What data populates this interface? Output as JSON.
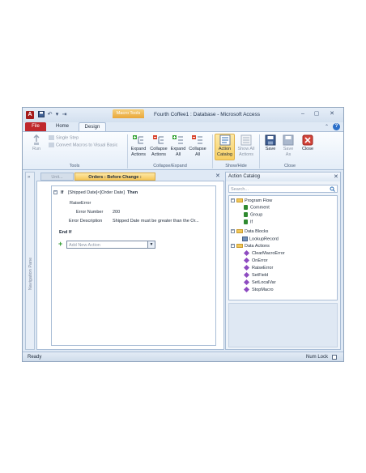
{
  "titlebar": {
    "app_icon": "A",
    "window_title": "Fourth Coffee1 : Database - Microsoft Access",
    "context_tab": "Macro Tools",
    "qat_icons": [
      "save-icon",
      "undo-icon",
      "redo-icon",
      "customize-icon"
    ],
    "controls": {
      "minimize": "–",
      "maximize": "▢",
      "close": "✕"
    }
  },
  "ribbon_tabs": {
    "file": "File",
    "home": "Home",
    "design": "Design",
    "active": "Design"
  },
  "ribbon": {
    "tools": {
      "label": "Tools",
      "run": "Run",
      "single_step": "Single Step",
      "convert": "Convert Macros to Visual Basic"
    },
    "collapse_expand": {
      "label": "Collapse/Expand",
      "expand_actions": [
        "Expand",
        "Actions"
      ],
      "collapse_actions": [
        "Collapse",
        "Actions"
      ],
      "expand_all": [
        "Expand",
        "All"
      ],
      "collapse_all": [
        "Collapse",
        "All"
      ]
    },
    "show_hide": {
      "label": "Show/Hide",
      "action_catalog": [
        "Action",
        "Catalog"
      ],
      "show_all_actions": [
        "Show All",
        "Actions"
      ]
    },
    "close": {
      "label": "Close",
      "save": "Save",
      "save_as": [
        "Save",
        "As"
      ],
      "close": "Close"
    }
  },
  "nav_pane": {
    "label": "Navigation Pane",
    "chevron": "»"
  },
  "doc_tabs": {
    "inactive": "Unit...",
    "active": "Orders : Before Change :",
    "close": "✕"
  },
  "macro": {
    "if_keyword": "If",
    "condition": "[Shipped Date]<[Order Date]",
    "then_keyword": "Then",
    "action": "RaiseError",
    "error_number_label": "Error Number",
    "error_number_value": "200",
    "error_description_label": "Error Description",
    "error_description_value": "Shipped Date must be greater than the Or...",
    "end_if": "End If",
    "add_new_action_placeholder": "Add New Action",
    "collapse_glyph": "−"
  },
  "catalog": {
    "title": "Action Catalog",
    "search_placeholder": "Search...",
    "groups": [
      {
        "name": "Program Flow",
        "items": [
          "Comment",
          "Group",
          "If"
        ]
      },
      {
        "name": "Data Blocks",
        "items": [
          "LookupRecord"
        ]
      },
      {
        "name": "Data Actions",
        "items": [
          "ClearMacroError",
          "OnError",
          "RaiseError",
          "SetField",
          "SetLocalVar",
          "StopMacro"
        ]
      }
    ]
  },
  "statusbar": {
    "left": "Ready",
    "right": "Num Lock"
  },
  "colors": {
    "accent_file": "#c0282d",
    "context_tab": "#e9a63a",
    "active_doc_tab": "#f6c75a"
  }
}
